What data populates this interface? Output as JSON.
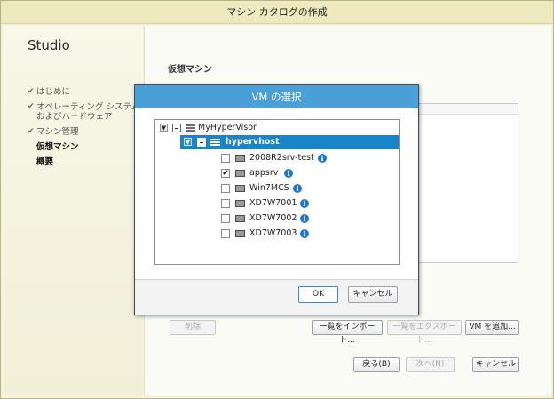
{
  "window": {
    "title": "マシン カタログの作成"
  },
  "sidebar": {
    "app_name": "Studio",
    "steps": [
      {
        "label": "はじめに",
        "done": true,
        "current": false
      },
      {
        "label": "オペレーティング システム\nおよびハードウェア",
        "done": true,
        "current": false
      },
      {
        "label": "マシン管理",
        "done": true,
        "current": false
      },
      {
        "label": "仮想マシン",
        "done": false,
        "current": true
      },
      {
        "label": "概要",
        "done": false,
        "current": false
      }
    ]
  },
  "main": {
    "heading": "仮想マシン",
    "buttons": {
      "delete": "削除",
      "import_list": "一覧をインポート...",
      "export_list": "一覧をエクスポート...",
      "add_vm": "VM を追加...",
      "back": "戻る(B)",
      "next": "次へ(N)",
      "cancel": "キャンセル"
    }
  },
  "dialog": {
    "title": "VM の選択",
    "tree": {
      "root": "MyHyperVisor",
      "host": "hypervhost",
      "vms": [
        {
          "name": "2008R2srv-test",
          "checked": false,
          "info": true
        },
        {
          "name": "appsrv",
          "checked": true,
          "info": true
        },
        {
          "name": "Win7MCS",
          "checked": false,
          "info": true
        },
        {
          "name": "XD7W7001",
          "checked": false,
          "info": true
        },
        {
          "name": "XD7W7002",
          "checked": false,
          "info": true
        },
        {
          "name": "XD7W7003",
          "checked": false,
          "info": true
        }
      ]
    },
    "ok": "OK",
    "cancel": "キャンセル"
  },
  "colors": {
    "dialog_title_bg": "#4a9fd8",
    "selection_bg": "#1a84c8",
    "info_icon": "#1e78c8"
  },
  "icons": {
    "check": "checkmark-icon",
    "info": "info-icon",
    "vm": "monitor-icon",
    "host": "server-icon"
  }
}
